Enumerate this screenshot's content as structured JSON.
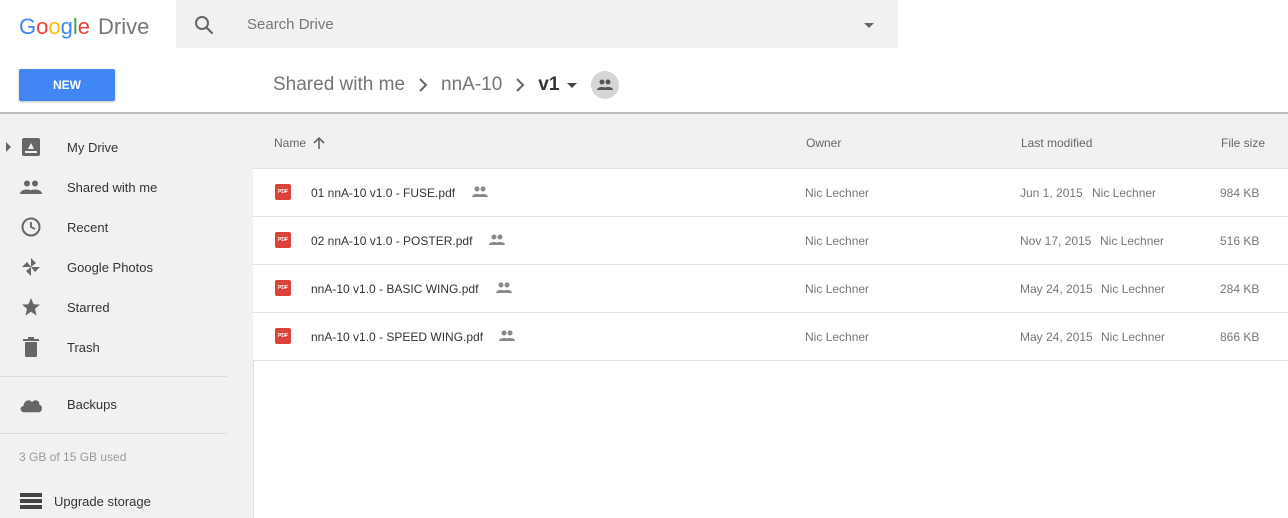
{
  "app": {
    "logo_letters": [
      "G",
      "o",
      "o",
      "g",
      "l",
      "e"
    ],
    "product": "Drive"
  },
  "search": {
    "placeholder": "Search Drive"
  },
  "toolbar": {
    "new_label": "NEW"
  },
  "breadcrumb": [
    {
      "label": "Shared with me"
    },
    {
      "label": "nnA-10"
    },
    {
      "label": "v1",
      "current": true
    }
  ],
  "sidebar": {
    "items": [
      {
        "label": "My Drive",
        "icon": "my-drive-icon"
      },
      {
        "label": "Shared with me",
        "icon": "people-icon"
      },
      {
        "label": "Recent",
        "icon": "clock-icon"
      },
      {
        "label": "Google Photos",
        "icon": "pinwheel-icon"
      },
      {
        "label": "Starred",
        "icon": "star-icon"
      },
      {
        "label": "Trash",
        "icon": "trash-icon"
      }
    ],
    "backups": {
      "label": "Backups",
      "icon": "cloud-icon"
    },
    "storage_text": "3 GB of 15 GB used",
    "upgrade": {
      "label": "Upgrade storage",
      "icon": "storage-icon"
    }
  },
  "list": {
    "columns": {
      "name": "Name",
      "owner": "Owner",
      "modified": "Last modified",
      "size": "File size"
    },
    "files": [
      {
        "icon_text": "PDF",
        "name": "01 nnA-10 v1.0 - FUSE.pdf",
        "owner": "Nic Lechner",
        "modified": "Jun 1, 2015",
        "modified_by": "Nic Lechner",
        "size": "984 KB"
      },
      {
        "icon_text": "PDF",
        "name": "02 nnA-10 v1.0 - POSTER.pdf",
        "owner": "Nic Lechner",
        "modified": "Nov 17, 2015",
        "modified_by": "Nic Lechner",
        "size": "516 KB"
      },
      {
        "icon_text": "PDF",
        "name": "nnA-10 v1.0 - BASIC WING.pdf",
        "owner": "Nic Lechner",
        "modified": "May 24, 2015",
        "modified_by": "Nic Lechner",
        "size": "284 KB"
      },
      {
        "icon_text": "PDF",
        "name": "nnA-10 v1.0 - SPEED WING.pdf",
        "owner": "Nic Lechner",
        "modified": "May 24, 2015",
        "modified_by": "Nic Lechner",
        "size": "866 KB"
      }
    ]
  },
  "colors": {
    "accent": "#4285f4",
    "pdf_red": "#db4437",
    "sidebar_bg": "#f1f1f1"
  }
}
